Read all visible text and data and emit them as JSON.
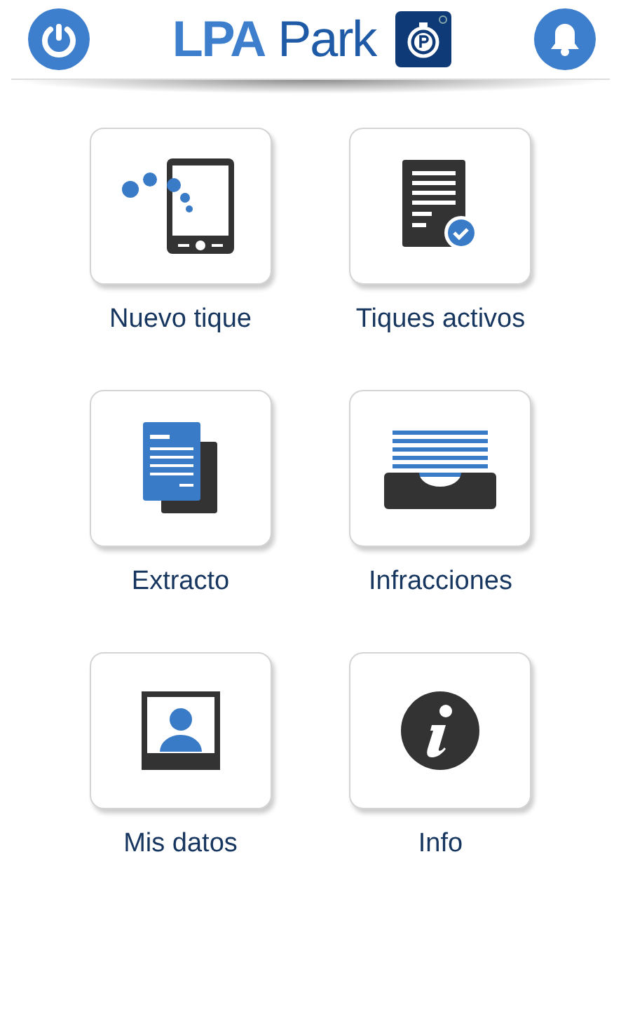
{
  "header": {
    "logo_strong": "LPA",
    "logo_light": "Park"
  },
  "tiles": [
    {
      "kind": "phone",
      "label": "Nuevo tique"
    },
    {
      "kind": "ticket",
      "label": "Tiques activos"
    },
    {
      "kind": "document",
      "label": "Extracto"
    },
    {
      "kind": "tray",
      "label": "Infracciones"
    },
    {
      "kind": "profile",
      "label": "Mis datos"
    },
    {
      "kind": "info",
      "label": "Info"
    }
  ]
}
